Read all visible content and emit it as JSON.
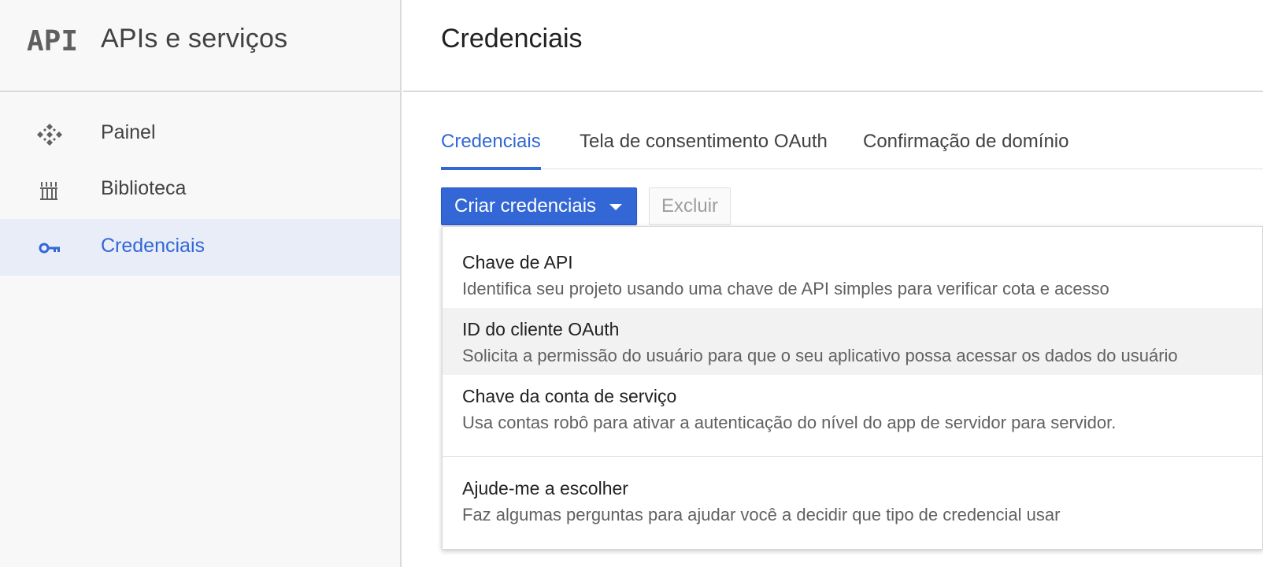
{
  "sidebar": {
    "logo": "API",
    "title": "APIs e serviços",
    "items": [
      {
        "label": "Painel",
        "icon": "dashboard-icon",
        "active": false
      },
      {
        "label": "Biblioteca",
        "icon": "library-icon",
        "active": false
      },
      {
        "label": "Credenciais",
        "icon": "key-icon",
        "active": true
      }
    ]
  },
  "main": {
    "title": "Credenciais",
    "tabs": [
      {
        "label": "Credenciais",
        "active": true
      },
      {
        "label": "Tela de consentimento OAuth",
        "active": false
      },
      {
        "label": "Confirmação de domínio",
        "active": false
      }
    ],
    "toolbar": {
      "create_label": "Criar credenciais",
      "delete_label": "Excluir"
    }
  },
  "menu": {
    "items": [
      {
        "title": "Chave de API",
        "description": "Identifica seu projeto usando uma chave de API simples para verificar cota e acesso"
      },
      {
        "title": "ID do cliente OAuth",
        "description": "Solicita a permissão do usuário para que o seu aplicativo possa acessar os dados do usuário"
      },
      {
        "title": "Chave da conta de serviço",
        "description": "Usa contas robô para ativar a autenticação do nível do app de servidor para servidor."
      },
      {
        "title": "Ajude-me a escolher",
        "description": "Faz algumas perguntas para ajudar você a decidir que tipo de credencial usar"
      }
    ]
  },
  "colors": {
    "accent": "#3367d6",
    "sidebar_bg": "#f8f8f8",
    "active_bg": "#e8edf7",
    "highlight_bg": "#f2f2f2"
  }
}
